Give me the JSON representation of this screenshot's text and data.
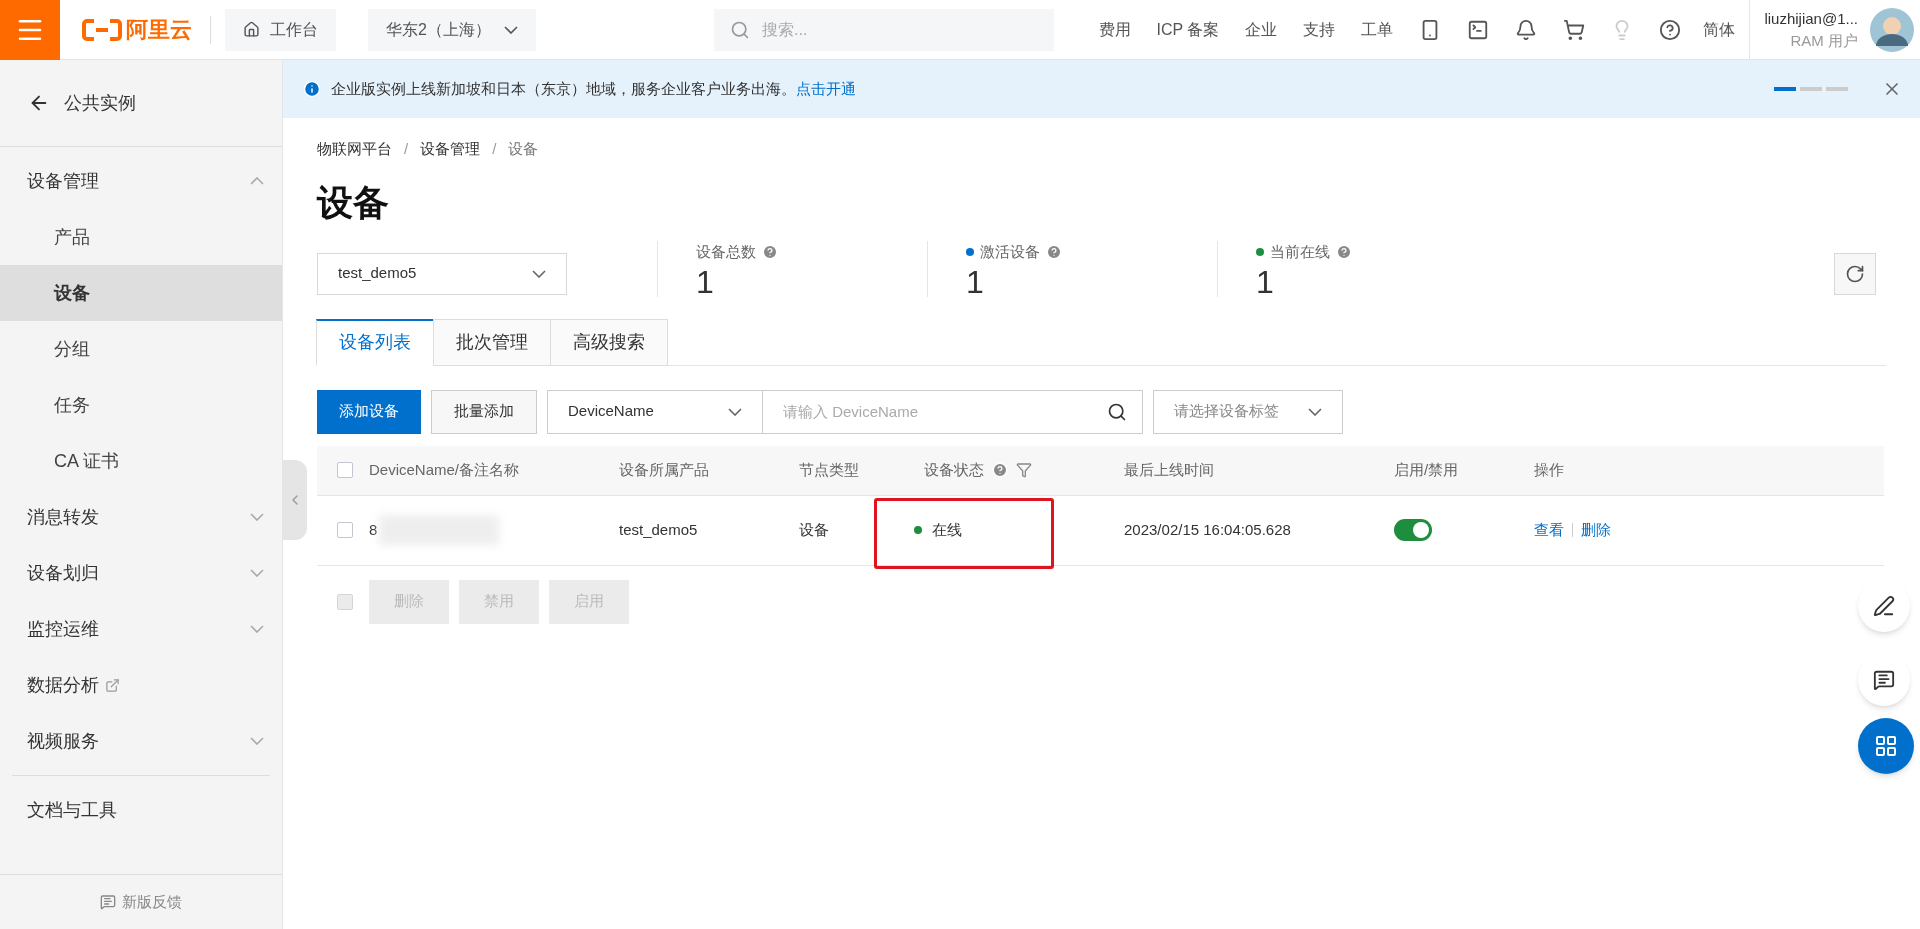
{
  "topbar": {
    "logo": "阿里云",
    "workbench": "工作台",
    "region": "华东2（上海）",
    "search_placeholder": "搜索...",
    "nav": [
      "费用",
      "ICP 备案",
      "企业",
      "支持",
      "工单"
    ],
    "language": "简体",
    "user": {
      "name": "liuzhijian@1...",
      "role": "RAM 用户"
    }
  },
  "sidebar": {
    "back": "公共实例",
    "items": [
      {
        "label": "设备管理",
        "kind": "group",
        "expanded": true,
        "children": [
          {
            "label": "产品",
            "selected": false
          },
          {
            "label": "设备",
            "selected": true
          },
          {
            "label": "分组",
            "selected": false
          },
          {
            "label": "任务",
            "selected": false
          },
          {
            "label": "CA 证书",
            "selected": false
          }
        ]
      },
      {
        "label": "消息转发",
        "kind": "group",
        "expanded": false
      },
      {
        "label": "设备划归",
        "kind": "group",
        "expanded": false
      },
      {
        "label": "监控运维",
        "kind": "group",
        "expanded": false
      },
      {
        "label": "数据分析",
        "kind": "external"
      },
      {
        "label": "视频服务",
        "kind": "group",
        "expanded": false
      },
      {
        "label": "文档与工具",
        "kind": "section"
      }
    ],
    "footer": "新版反馈"
  },
  "banner": {
    "text": "企业版实例上线新加坡和日本（东京）地域，服务企业客户业务出海。",
    "link": "点击开通"
  },
  "breadcrumb": {
    "separator": "/",
    "items": [
      "物联网平台",
      "设备管理",
      "设备"
    ]
  },
  "title": "设备",
  "product_select": "test_demo5",
  "stats": [
    {
      "label": "设备总数",
      "value": "1"
    },
    {
      "label": "激活设备",
      "value": "1",
      "color": "#0070cc"
    },
    {
      "label": "当前在线",
      "value": "1",
      "color": "#1e8e3e"
    }
  ],
  "tabs": [
    {
      "label": "设备列表",
      "selected": true
    },
    {
      "label": "批次管理",
      "selected": false
    },
    {
      "label": "高级搜索",
      "selected": false
    }
  ],
  "toolbar": {
    "add": "添加设备",
    "batch_add": "批量添加",
    "filter": "DeviceName",
    "search_placeholder": "请输入 DeviceName",
    "tag_placeholder": "请选择设备标签"
  },
  "table": {
    "select_all_checked": false,
    "bulk_select": {
      "checked": false,
      "disabled": true
    },
    "columns": [
      "DeviceName/备注名称",
      "设备所属产品",
      "节点类型",
      "设备状态",
      "最后上线时间",
      "启用/禁用",
      "操作"
    ],
    "rows": [
      {
        "checked": false,
        "name": "8",
        "product": "test_demo5",
        "node_type": "设备",
        "status": "在线",
        "online": true,
        "highlighted": true,
        "last_online": "2023/02/15 16:04:05.628",
        "enabled": true,
        "actions": [
          "查看",
          "删除"
        ]
      }
    ],
    "bulk_actions": [
      {
        "label": "删除",
        "disabled": true
      },
      {
        "label": "禁用",
        "disabled": true
      },
      {
        "label": "启用",
        "disabled": true
      }
    ]
  }
}
